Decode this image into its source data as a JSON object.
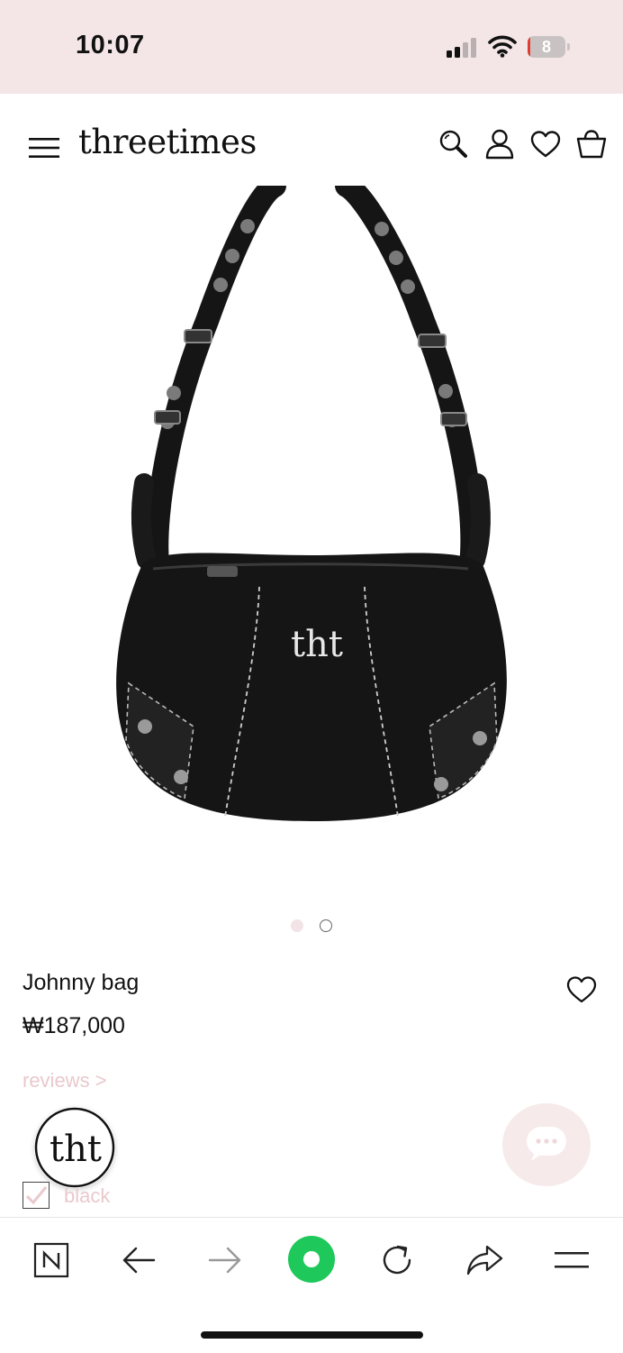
{
  "status_bar": {
    "time": "10:07",
    "battery_level": "8",
    "battery_fraction": 0.08,
    "background": "#f4e6e7"
  },
  "header": {
    "brand": "threetimes",
    "icons": [
      "menu-icon",
      "search-icon",
      "account-icon",
      "wishlist-icon",
      "cart-icon"
    ]
  },
  "product": {
    "image_icon": "black-shoulder-bag",
    "bag_logo": "tht",
    "carousel": {
      "count": 2,
      "active": 1
    },
    "name": "Johnny bag",
    "price": "₩187,000",
    "reviews_link": "reviews >",
    "option_label": "black"
  },
  "floating": {
    "brand_badge_text": "tht",
    "chat_icon": "chat-bubble-icon"
  },
  "browser_toolbar": {
    "icons": [
      "naver-n-icon",
      "back-arrow-icon",
      "forward-arrow-icon",
      "green-home-icon",
      "reload-icon",
      "share-icon",
      "menu-icon"
    ],
    "accent_color": "#1ec85a"
  },
  "colors": {
    "accent_pink": "#e9c9cd",
    "bag": "#111111"
  }
}
